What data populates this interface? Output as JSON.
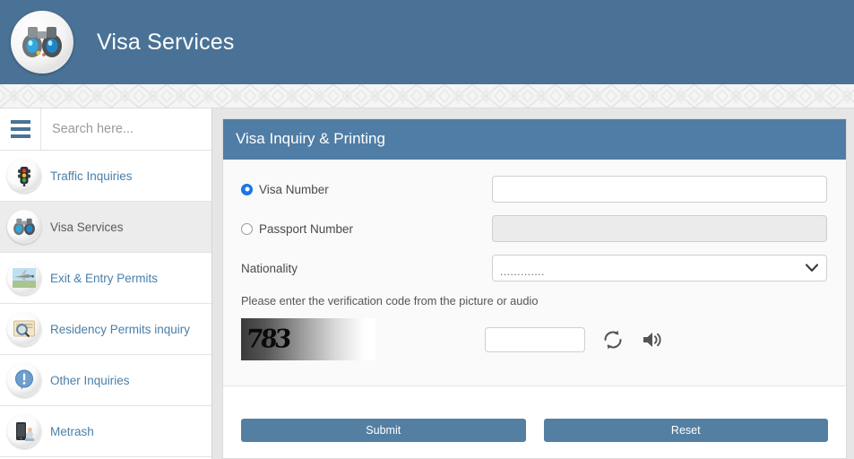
{
  "header": {
    "title": "Visa Services",
    "logo_icon": "binoculars-icon",
    "bg_color": "#4a7296"
  },
  "sidebar": {
    "menu_icon": "hamburger-icon",
    "search": {
      "placeholder": "Search here...",
      "value": ""
    },
    "items": [
      {
        "label": "Traffic Inquiries",
        "icon": "traffic-light-icon",
        "active": false
      },
      {
        "label": "Visa Services",
        "icon": "binoculars-icon",
        "active": true
      },
      {
        "label": "Exit & Entry Permits",
        "icon": "airplane-icon",
        "active": false
      },
      {
        "label": "Residency Permits inquiry",
        "icon": "document-search-icon",
        "active": false
      },
      {
        "label": "Other Inquiries",
        "icon": "info-bubble-icon",
        "active": false
      },
      {
        "label": "Metrash",
        "icon": "mobile-phone-icon",
        "active": false
      }
    ]
  },
  "panel": {
    "title": "Visa Inquiry & Printing",
    "header_color": "#4f7da5",
    "visa_number": {
      "label": "Visa Number",
      "selected": true,
      "value": ""
    },
    "passport_number": {
      "label": "Passport Number",
      "selected": false,
      "value": "",
      "disabled": true
    },
    "nationality": {
      "label": "Nationality",
      "selected_option": ".............",
      "dropdown_icon": "chevron-down-icon"
    },
    "captcha": {
      "hint": "Please enter the verification code from the picture or audio",
      "image_text": "783",
      "input_value": "",
      "refresh_icon": "refresh-icon",
      "audio_icon": "speaker-icon"
    },
    "buttons": {
      "submit": "Submit",
      "reset": "Reset",
      "color": "#537fa3"
    }
  }
}
